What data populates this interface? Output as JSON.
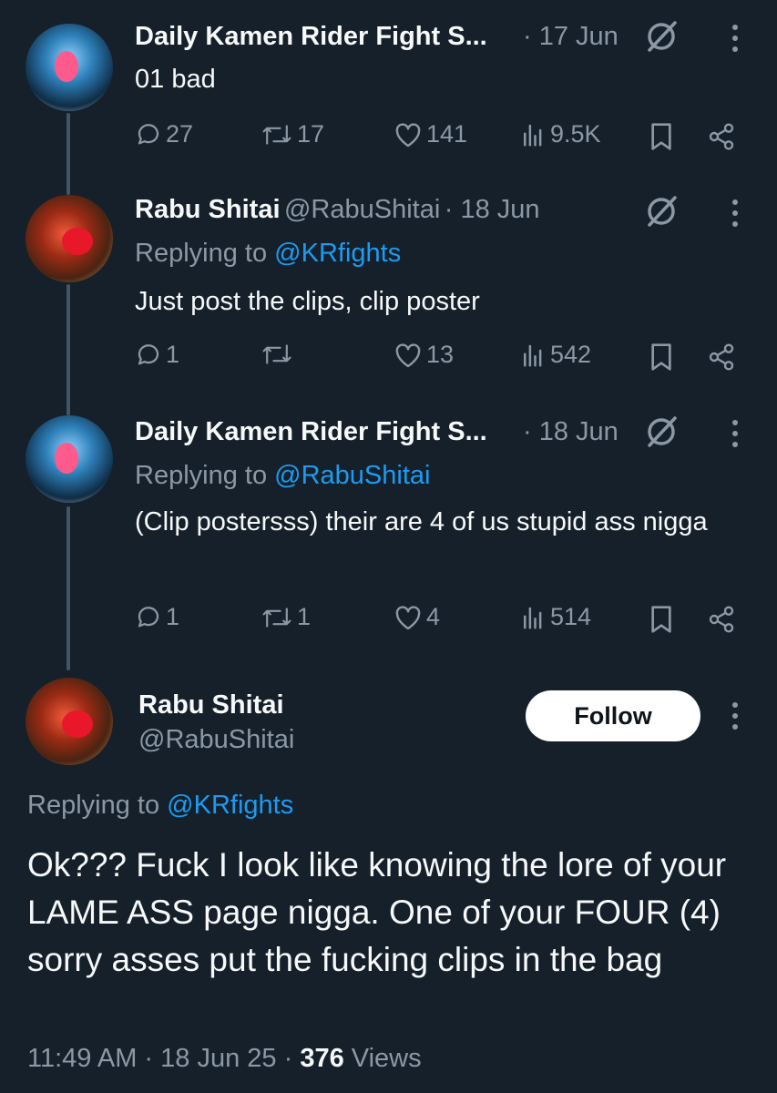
{
  "tweets": [
    {
      "author": "Daily Kamen Rider Fight S...",
      "date": "· 17 Jun",
      "text": "01 bad",
      "replies": "27",
      "retweets": "17",
      "likes": "141",
      "views": "9.5K"
    },
    {
      "author": "Rabu Shitai",
      "handle": "@RabuShitai",
      "date": "· 18 Jun",
      "replying_label": "Replying to",
      "replying_to": "@KRfights",
      "text": "Just post the clips, clip poster",
      "replies": "1",
      "retweets": "",
      "likes": "13",
      "views": "542"
    },
    {
      "author": "Daily Kamen Rider Fight S...",
      "date": "· 18 Jun",
      "replying_label": "Replying to",
      "replying_to": "@RabuShitai",
      "text": "(Clip postersss) their are 4 of us stupid ass nigga",
      "replies": "1",
      "retweets": "1",
      "likes": "4",
      "views": "514"
    }
  ],
  "main": {
    "author": "Rabu Shitai",
    "handle": "@RabuShitai",
    "follow_label": "Follow",
    "replying_label": "Replying to",
    "replying_to": "@KRfights",
    "text": "Ok??? Fuck I look like knowing the lore of your LAME ASS page nigga. One of your FOUR (4) sorry asses put the fucking clips in the bag",
    "time": "11:49 AM · 18 Jun 25 ·",
    "views_count": "376",
    "views_label": "Views"
  },
  "colors": {
    "background": "#15202b",
    "muted": "#8b98a5",
    "accent": "#1d9bf0"
  },
  "icons": [
    "reply-icon",
    "retweet-icon",
    "like-icon",
    "views-icon",
    "bookmark-icon",
    "share-icon",
    "grok-icon",
    "more-icon"
  ]
}
